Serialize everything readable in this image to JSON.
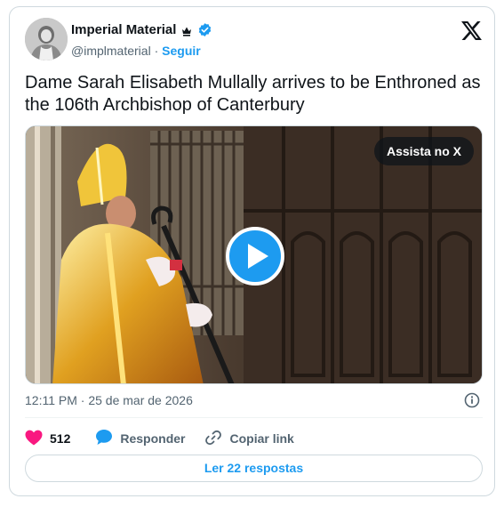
{
  "author": {
    "name": "Imperial Material",
    "handle": "@implmaterial",
    "separator": "·",
    "follow_label": "Seguir"
  },
  "tweet": {
    "text": "Dame Sarah Elisabeth Mullally arrives to be Enthroned as the 106th Archbishop of Canterbury",
    "timestamp": "12:11 PM · 25 de mar de 2026"
  },
  "media": {
    "watch_label": "Assista no X"
  },
  "actions": {
    "likes": "512",
    "reply_label": "Responder",
    "copy_label": "Copiar link"
  },
  "replies_button": "Ler 22 respostas",
  "colors": {
    "accent": "#1d9bf0",
    "like": "#f91880",
    "text": "#0f1419",
    "secondary": "#536471"
  },
  "icons": [
    "crown-icon",
    "verified-icon",
    "x-logo-icon",
    "play-icon",
    "info-icon",
    "heart-icon",
    "reply-icon",
    "link-icon"
  ]
}
